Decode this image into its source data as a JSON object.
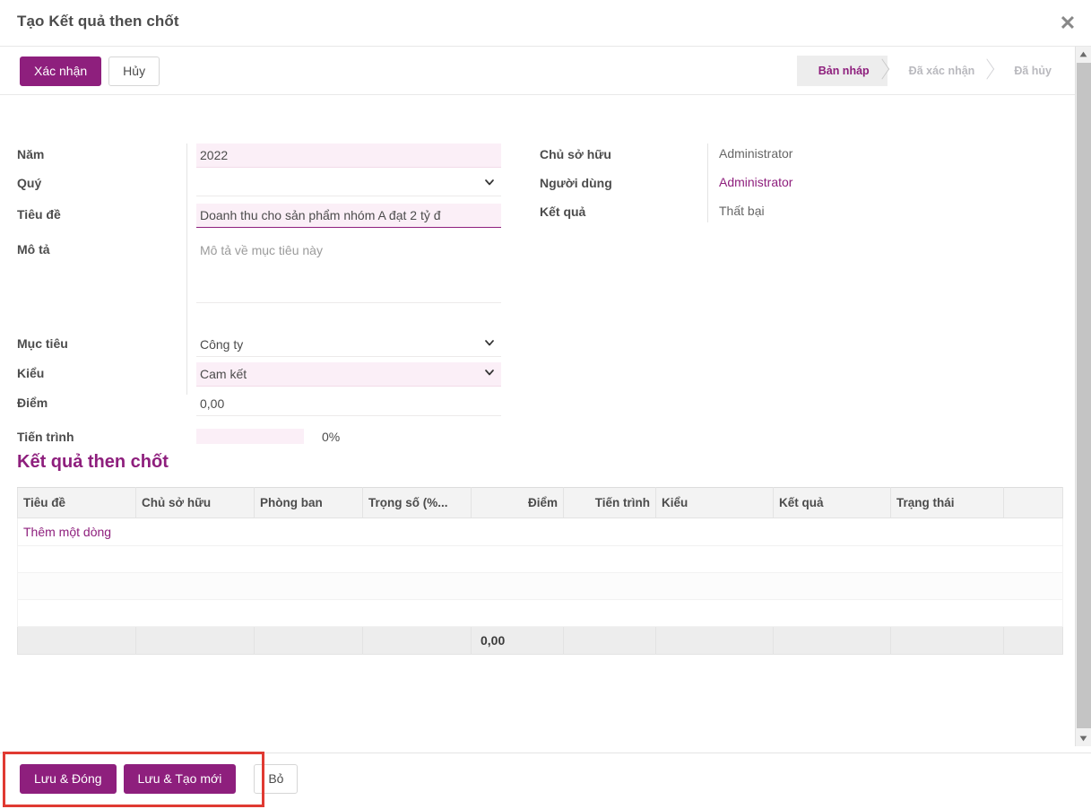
{
  "modal": {
    "title": "Tạo Kết quả then chốt",
    "close_icon": "close-icon"
  },
  "workflow": {
    "confirm_label": "Xác nhận",
    "cancel_label": "Hủy"
  },
  "statusbar": {
    "stages": [
      {
        "label": "Bản nháp",
        "active": true
      },
      {
        "label": "Đã xác nhận",
        "active": false
      },
      {
        "label": "Đã hủy",
        "active": false
      }
    ]
  },
  "form": {
    "left": [
      {
        "label": "Năm",
        "value": "2022"
      },
      {
        "label": "Quý",
        "value": ""
      },
      {
        "label": "Tiêu đề",
        "value": "Doanh thu cho sản phẩm nhóm A đạt 2 tỷ đ"
      },
      {
        "label": "Mô tả",
        "value": "",
        "placeholder": "Mô tả về mục tiêu này"
      },
      {
        "label": "Mục tiêu",
        "value": "Công ty"
      },
      {
        "label": "Kiểu",
        "value": "Cam kết"
      },
      {
        "label": "Điểm",
        "value": "0,00"
      },
      {
        "label": "Tiến trình",
        "value": "0%"
      }
    ],
    "progress": {
      "percent_label": "0%",
      "percent": 0
    },
    "right": [
      {
        "label": "Chủ sở hữu",
        "value": "Administrator",
        "link": false
      },
      {
        "label": "Người dùng",
        "value": "Administrator",
        "link": true
      },
      {
        "label": "Kết quả",
        "value": "Thất bại",
        "link": false
      }
    ]
  },
  "section": {
    "title": "Kết quả then chốt",
    "columns": [
      {
        "label": "Tiêu đề",
        "align": "left"
      },
      {
        "label": "Chủ sở hữu",
        "align": "left"
      },
      {
        "label": "Phòng ban",
        "align": "left"
      },
      {
        "label": "Trọng số (%...",
        "align": "left"
      },
      {
        "label": "Điểm",
        "align": "right"
      },
      {
        "label": "Tiến trình",
        "align": "right"
      },
      {
        "label": "Kiểu",
        "align": "left"
      },
      {
        "label": "Kết quả",
        "align": "left"
      },
      {
        "label": "Trạng thái",
        "align": "left"
      },
      {
        "label": "",
        "align": "left"
      }
    ],
    "add_row_label": "Thêm một dòng",
    "rows": [],
    "total_value": "0,00"
  },
  "footer": {
    "save_close_label": "Lưu & Đóng",
    "save_new_label": "Lưu & Tạo mới",
    "discard_label": "Bỏ"
  },
  "colors": {
    "accent": "#8e1f7d",
    "field_highlight": "#fbeff7",
    "annotation": "#e03a32",
    "header_bg": "#f3f3f3"
  }
}
